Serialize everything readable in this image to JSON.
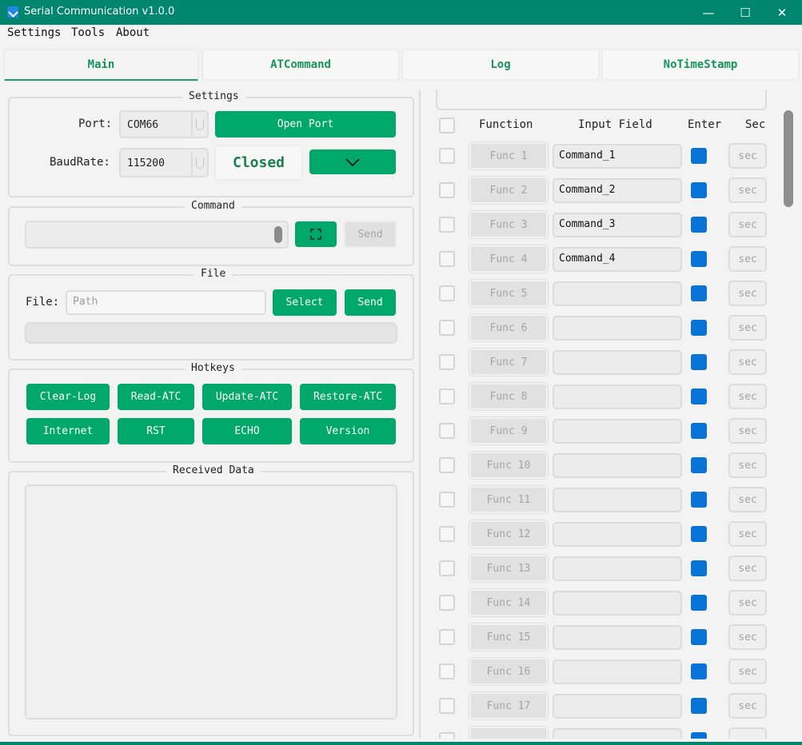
{
  "window": {
    "title": "Serial Communication v1.0.0",
    "controls": {
      "minimize": "—",
      "maximize": "☐",
      "close": "✕"
    }
  },
  "menu": {
    "items": [
      "Settings",
      "Tools",
      "About"
    ]
  },
  "tabs": [
    "Main",
    "ATCommand",
    "Log",
    "NoTimeStamp"
  ],
  "settings": {
    "title": "Settings",
    "port_label": "Port:",
    "port_value": "COM66",
    "open_port_label": "Open Port",
    "baud_label": "BaudRate:",
    "baud_value": "115200",
    "status": "Closed",
    "dropdown_icon": "chevron-down"
  },
  "command": {
    "title": "Command",
    "input_value": "",
    "send_label": "Send"
  },
  "file": {
    "title": "File",
    "label": "File:",
    "path_placeholder": "Path",
    "select_label": "Select",
    "send_label": "Send"
  },
  "hotkeys": {
    "title": "Hotkeys",
    "buttons": [
      "Clear-Log",
      "Read-ATC",
      "Update-ATC",
      "Restore-ATC",
      "Internet",
      "RST",
      "ECHO",
      "Version"
    ]
  },
  "received": {
    "title": "Received Data",
    "content": ""
  },
  "functions": {
    "headers": {
      "function": "Function",
      "input": "Input Field",
      "enter": "Enter",
      "sec": "Sec"
    },
    "rows": [
      {
        "label": "Func 1",
        "value": "Command_1",
        "sec": "sec"
      },
      {
        "label": "Func 2",
        "value": "Command_2",
        "sec": "sec"
      },
      {
        "label": "Func 3",
        "value": "Command_3",
        "sec": "sec"
      },
      {
        "label": "Func 4",
        "value": "Command_4",
        "sec": "sec"
      },
      {
        "label": "Func 5",
        "value": "",
        "sec": "sec"
      },
      {
        "label": "Func 6",
        "value": "",
        "sec": "sec"
      },
      {
        "label": "Func 7",
        "value": "",
        "sec": "sec"
      },
      {
        "label": "Func 8",
        "value": "",
        "sec": "sec"
      },
      {
        "label": "Func 9",
        "value": "",
        "sec": "sec"
      },
      {
        "label": "Func 10",
        "value": "",
        "sec": "sec"
      },
      {
        "label": "Func 11",
        "value": "",
        "sec": "sec"
      },
      {
        "label": "Func 12",
        "value": "",
        "sec": "sec"
      },
      {
        "label": "Func 13",
        "value": "",
        "sec": "sec"
      },
      {
        "label": "Func 14",
        "value": "",
        "sec": "sec"
      },
      {
        "label": "Func 15",
        "value": "",
        "sec": "sec"
      },
      {
        "label": "Func 16",
        "value": "",
        "sec": "sec"
      },
      {
        "label": "Func 17",
        "value": "",
        "sec": "sec"
      }
    ]
  },
  "colors": {
    "titlebar": "#00856f",
    "accent_green": "#00a86b",
    "enter_blue": "#0a74d6",
    "status_green": "#1a7f4e"
  }
}
